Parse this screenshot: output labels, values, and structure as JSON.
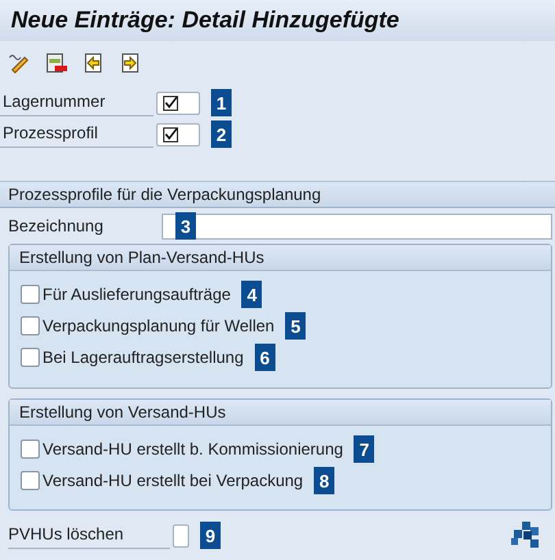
{
  "window": {
    "title": "Neue Einträge: Detail Hinzugefügte"
  },
  "toolbar": [
    {
      "kind": "edit"
    },
    {
      "kind": "delete"
    },
    {
      "kind": "previous"
    },
    {
      "kind": "next"
    }
  ],
  "key_fields": [
    {
      "label": "Lagernummer",
      "checked": true,
      "marker": "1"
    },
    {
      "label": "Prozessprofil",
      "checked": true,
      "marker": "2"
    }
  ],
  "section": {
    "title": "Prozessprofile für die Verpackungsplanung",
    "name_field": {
      "label": "Bezeichnung",
      "marker": "3"
    },
    "groups": [
      {
        "title": "Erstellung von Plan-Versand-HUs",
        "options": [
          {
            "label": "Für Auslieferungsaufträge",
            "checked": false,
            "marker": "4"
          },
          {
            "label": "Verpackungsplanung für Wellen",
            "checked": false,
            "marker": "5"
          },
          {
            "label": "Bei Lagerauftragserstellung",
            "checked": false,
            "marker": "6"
          }
        ]
      },
      {
        "title": "Erstellung von Versand-HUs",
        "options": [
          {
            "label": "Versand-HU erstellt b. Kommissionierung",
            "checked": false,
            "marker": "7"
          },
          {
            "label": "Versand-HU erstellt bei Verpackung",
            "checked": false,
            "marker": "8"
          }
        ]
      }
    ]
  },
  "delete_field": {
    "label": "PVHUs löschen",
    "checked": false,
    "marker": "9"
  }
}
